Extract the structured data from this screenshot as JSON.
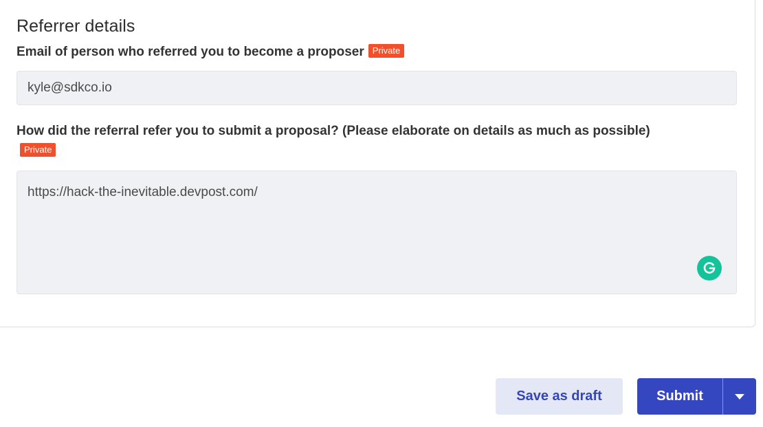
{
  "section": {
    "title": "Referrer details"
  },
  "fields": [
    {
      "label": "Email of person who referred you to become a proposer",
      "badge": "Private",
      "value": "kyle@sdkco.io"
    },
    {
      "label": "How did the referral refer you to submit a proposal? (Please elaborate on details as much as possible)",
      "badge": "Private",
      "value": "https://hack-the-inevitable.devpost.com/"
    }
  ],
  "actions": {
    "save_draft": "Save as draft",
    "submit": "Submit"
  },
  "icons": {
    "grammarly": "grammarly-icon",
    "dropdown": "caret-down-icon"
  },
  "colors": {
    "badge": "#f0512c",
    "primary": "#3446c0",
    "secondary_bg": "#e3e7f6",
    "grammarly": "#15c39a"
  }
}
